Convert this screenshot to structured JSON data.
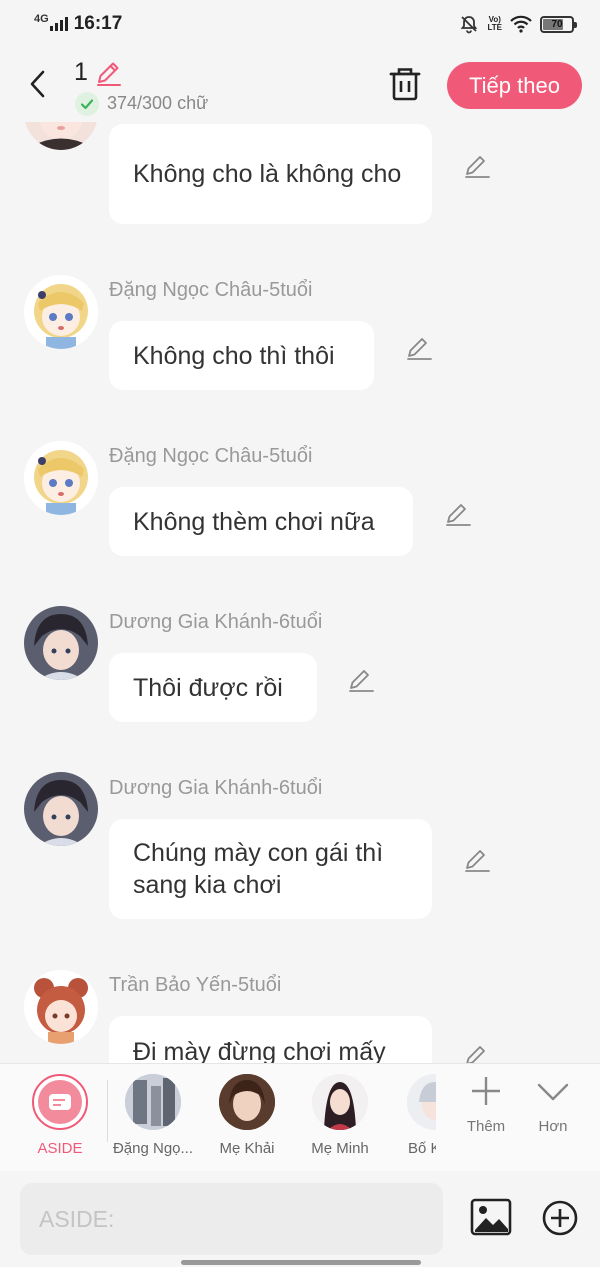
{
  "status_bar": {
    "network": "4G",
    "time": "16:17",
    "volte_top": "Vo)",
    "volte_bottom": "LTE",
    "battery": "70",
    "battery_level_percent": 70
  },
  "header": {
    "story_number": "1",
    "char_count": "374/300 chữ",
    "next_label": "Tiếp theo",
    "accent_color": "#f05a78"
  },
  "messages": [
    {
      "sender": "",
      "text": "Không cho là không cho",
      "avatar": "girl-avatar-partial"
    },
    {
      "sender": "Đặng Ngọc Châu-5tuổi",
      "text": "Không cho thì thôi",
      "avatar": "blonde-girl-avatar"
    },
    {
      "sender": "Đặng Ngọc Châu-5tuổi",
      "text": "Không thèm chơi nữa",
      "avatar": "blonde-girl-avatar"
    },
    {
      "sender": "Dương Gia Khánh-6tuổi",
      "text": "Thôi được rồi",
      "avatar": "dark-hair-boy-avatar"
    },
    {
      "sender": "Dương Gia Khánh-6tuổi",
      "text": "Chúng mày con gái thì sang kia chơi",
      "avatar": "dark-hair-boy-avatar"
    },
    {
      "sender": "Trần Bảo Yến-5tuổi",
      "text": "Đi mày đừng chơi mấy",
      "avatar": "red-hair-girl-avatar"
    }
  ],
  "characters": [
    {
      "name": "ASIDE",
      "selected": true
    },
    {
      "name": "Đặng Ngọ..."
    },
    {
      "name": "Mẹ Khải"
    },
    {
      "name": "Mẹ Minh"
    },
    {
      "name": "Bố K"
    }
  ],
  "tools": {
    "add_label": "Thêm",
    "more_label": "Hơn"
  },
  "input": {
    "placeholder": "ASIDE:"
  }
}
